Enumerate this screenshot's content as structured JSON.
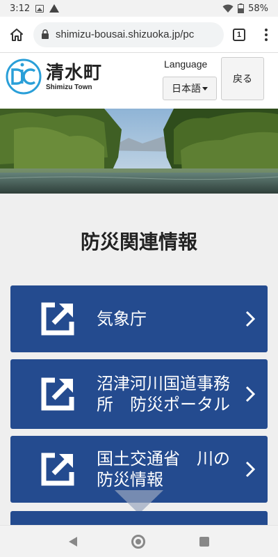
{
  "status_bar": {
    "time": "3:12",
    "battery": "58%",
    "icons": [
      "image-icon",
      "warning-icon",
      "wifi-icon",
      "battery-icon"
    ]
  },
  "browser": {
    "url": "shimizu-bousai.shizuoka.jp/pc",
    "tab_count": "1",
    "icons": [
      "home-icon",
      "lock-icon",
      "more-vert-icon"
    ]
  },
  "header": {
    "logo_kanji": "清水町",
    "logo_roman": "Shimizu Town",
    "language_label": "Language",
    "language_selected": "日本語",
    "back_label": "戻る"
  },
  "page": {
    "title": "防災関連情報",
    "links": [
      {
        "label": "気象庁",
        "icon": "external-link-icon"
      },
      {
        "label": "沼津河川国道事務所　防災ポータル",
        "icon": "external-link-icon"
      },
      {
        "label": "国土交通省　川の防災情報",
        "icon": "external-link-icon"
      },
      {
        "label": "",
        "icon": "external-link-icon"
      }
    ]
  },
  "colors": {
    "card_blue": "#244b8f",
    "logo_blue": "#2a9fd8",
    "background": "#efefef"
  },
  "nav_bar": {
    "icons": [
      "back-triangle-icon",
      "home-circle-icon",
      "recents-square-icon"
    ]
  }
}
